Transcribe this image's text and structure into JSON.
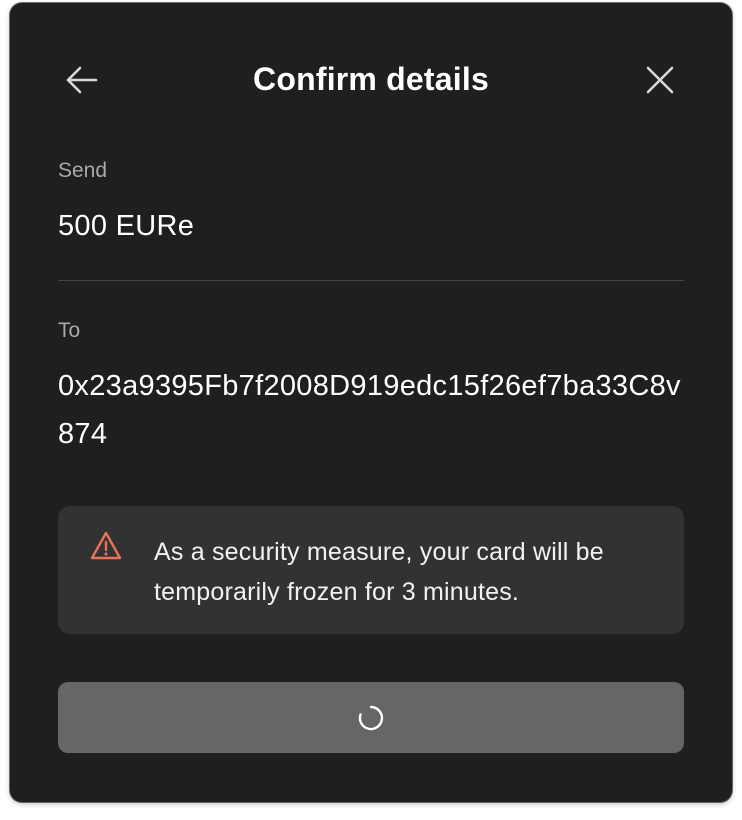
{
  "header": {
    "title": "Confirm details",
    "back_icon": "arrow-left-icon",
    "close_icon": "close-icon"
  },
  "send": {
    "label": "Send",
    "value": "500 EURe"
  },
  "to": {
    "label": "To",
    "value": "0x23a9395Fb7f2008D919edc15f26ef7ba33C8v874"
  },
  "notice": {
    "icon": "warning-triangle-icon",
    "text": "As a security measure, your card will be temporarily frozen for 3 minutes."
  },
  "confirm_button": {
    "state": "loading",
    "icon": "spinner-icon"
  },
  "colors": {
    "modal_background": "#1f1f1f",
    "notice_background": "#323232",
    "button_background": "#666666",
    "warning_accent": "#e8735a",
    "label_text": "#a8a8a8"
  }
}
